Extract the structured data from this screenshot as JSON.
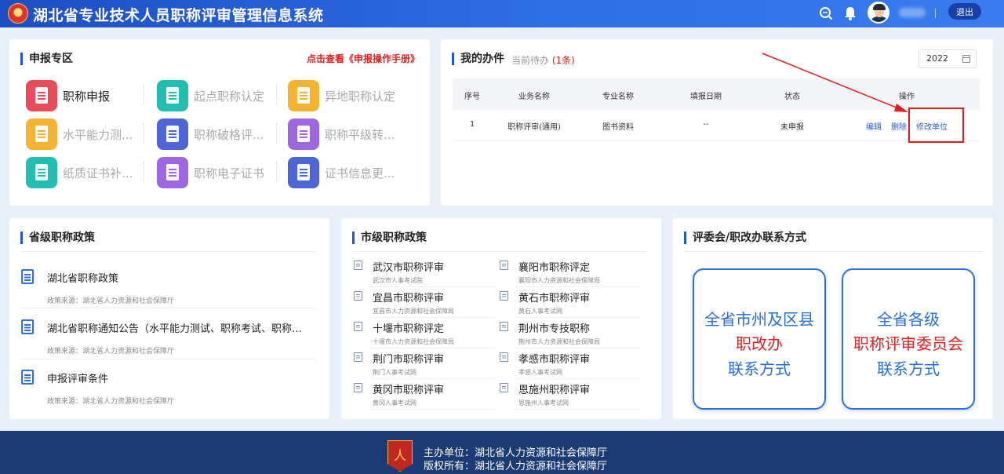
{
  "header": {
    "title": "湖北省专业技术人员职称评审管理信息系统",
    "logout_label": "退出",
    "icons": [
      "search-icon",
      "bell-icon"
    ]
  },
  "apply_zone": {
    "title": "申报专区",
    "manual_link": "点击查看《申报操作手册》",
    "items": [
      {
        "label": "职称申报",
        "active": true,
        "color": "#e94b5b",
        "icon": "document-icon"
      },
      {
        "label": "起点职称认定",
        "active": false,
        "color": "#22bfb0",
        "icon": "check-icon"
      },
      {
        "label": "异地职称认定",
        "active": false,
        "color": "#f5b333",
        "icon": "building-icon"
      },
      {
        "label": "水平能力测...",
        "active": false,
        "color": "#f5b333",
        "icon": "edit-icon"
      },
      {
        "label": "职称破格评...",
        "active": false,
        "color": "#4f67d6",
        "icon": "cabinet-icon"
      },
      {
        "label": "职称平级转...",
        "active": false,
        "color": "#9d67e0",
        "icon": "briefcase-icon"
      },
      {
        "label": "纸质证书补...",
        "active": false,
        "color": "#22bfb0",
        "icon": "certificate-icon"
      },
      {
        "label": "职称电子证书",
        "active": false,
        "color": "#9d67e0",
        "icon": "badge-icon"
      },
      {
        "label": "证书信息更...",
        "active": false,
        "color": "#4f67d6",
        "icon": "refresh-icon"
      }
    ]
  },
  "my_tasks": {
    "title": "我的办件",
    "pending_label": "当前待办",
    "pending_count": "(1条)",
    "year": "2022",
    "columns": [
      "序号",
      "业务名称",
      "专业名称",
      "填报日期",
      "状态",
      "操作"
    ],
    "rows": [
      {
        "index": "1",
        "business": "职称评审(通用)",
        "major": "图书资料",
        "date": "--",
        "status": "未申报",
        "actions": [
          "编辑",
          "删除",
          "修改单位"
        ]
      }
    ]
  },
  "province_policy": {
    "title": "省级职称政策",
    "items": [
      {
        "title": "湖北省职称政策",
        "source": "政策来源：湖北省人力资源和社会保障厅"
      },
      {
        "title": "湖北省职称通知公告（水平能力测试、职称考试、职称评审等）",
        "source": "政策来源：湖北省人力资源和社会保障厅"
      },
      {
        "title": "申报评审条件",
        "source": "政策来源：湖北省人力资源和社会保障厅"
      }
    ]
  },
  "city_policy": {
    "title": "市级职称政策",
    "items": [
      {
        "name": "武汉市职称评审",
        "sub": "武汉市人事考试院"
      },
      {
        "name": "襄阳市职称评定",
        "sub": "襄阳市人力资源和社会保障局"
      },
      {
        "name": "宜昌市职称评审",
        "sub": "宜昌市人力资源和社会保障局"
      },
      {
        "name": "黄石市职称评审",
        "sub": "黄石人事考试网"
      },
      {
        "name": "十堰市职称评定",
        "sub": "十堰市人力资源和社会保障局"
      },
      {
        "name": "荆州市专技职称",
        "sub": "荆州市人力资源和社会保障局"
      },
      {
        "name": "荆门市职称评审",
        "sub": "荆门人事考试网"
      },
      {
        "name": "孝感市职称评审",
        "sub": "孝感人事考试网"
      },
      {
        "name": "黄冈市职称评审",
        "sub": "黄冈人事考试网"
      },
      {
        "name": "恩施州职称评审",
        "sub": "恩施州人事考试网"
      }
    ]
  },
  "contacts": {
    "title": "评委会/职改办联系方式",
    "cards": [
      {
        "line1": "全省市州及区县",
        "line2": "职改办",
        "line3": "联系方式"
      },
      {
        "line1": "全省各级",
        "line2": "职称评审委员会",
        "line3": "联系方式"
      }
    ]
  },
  "footer": {
    "host": "主办单位：湖北省人力资源和社会保障厅",
    "copyright": "版权所有：湖北省人力资源和社会保障厅",
    "logo_text": "人"
  },
  "colors": {
    "primary": "#2f6ee6",
    "accent_red": "#e02020",
    "footer": "#1c3a74"
  }
}
